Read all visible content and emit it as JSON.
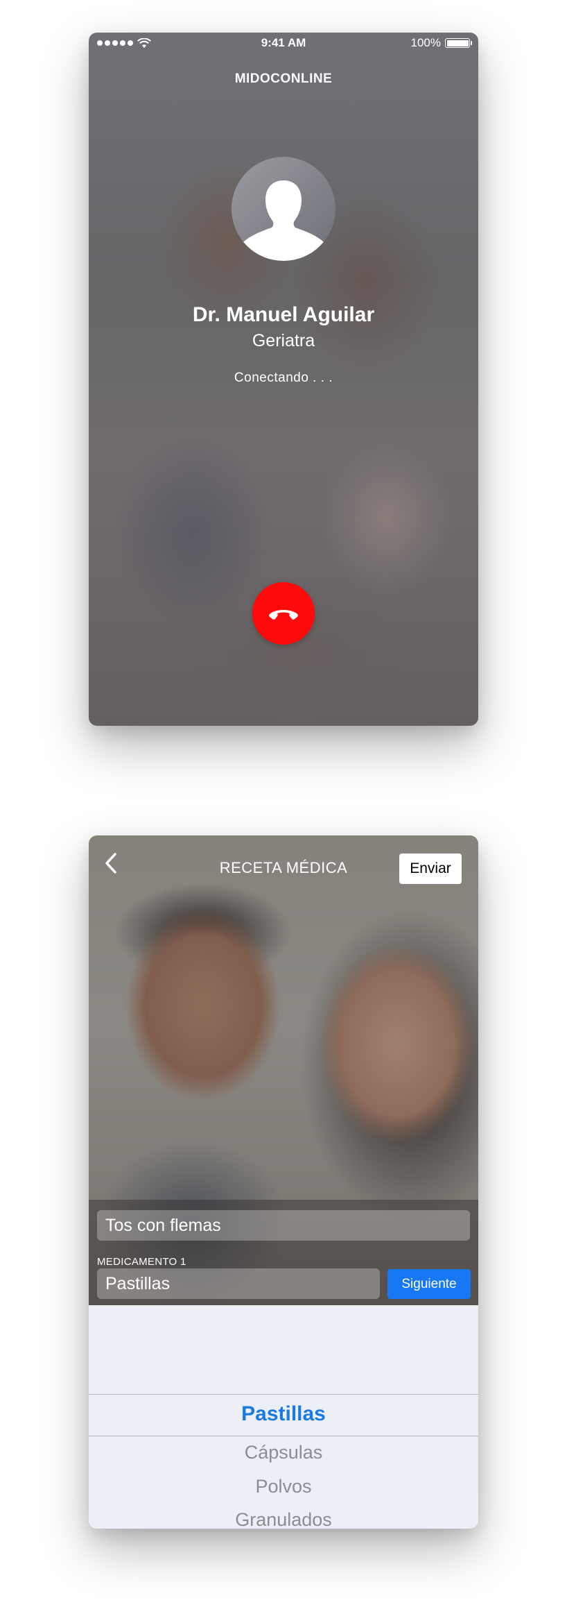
{
  "call_screen": {
    "status_bar": {
      "time": "9:41 AM",
      "battery": "100%"
    },
    "app_title": "MIDOCONLINE",
    "doctor": {
      "name": "Dr. Manuel Aguilar",
      "specialty": "Geriatra"
    },
    "call_status": "Conectando . . .",
    "hangup_color": "#ff0a0a"
  },
  "prescription_screen": {
    "nav": {
      "title": "RECETA MÉDICA",
      "send_label": "Enviar"
    },
    "symptom_value": "Tos con flemas",
    "medication_label": "MEDICAMENTO 1",
    "medication_value": "Pastillas",
    "next_label": "Siguiente",
    "accent_color": "#1877f2",
    "picker": {
      "options": [
        "Pastillas",
        "Cápsulas",
        "Polvos",
        "Granulados"
      ],
      "selected": "Pastillas"
    }
  }
}
